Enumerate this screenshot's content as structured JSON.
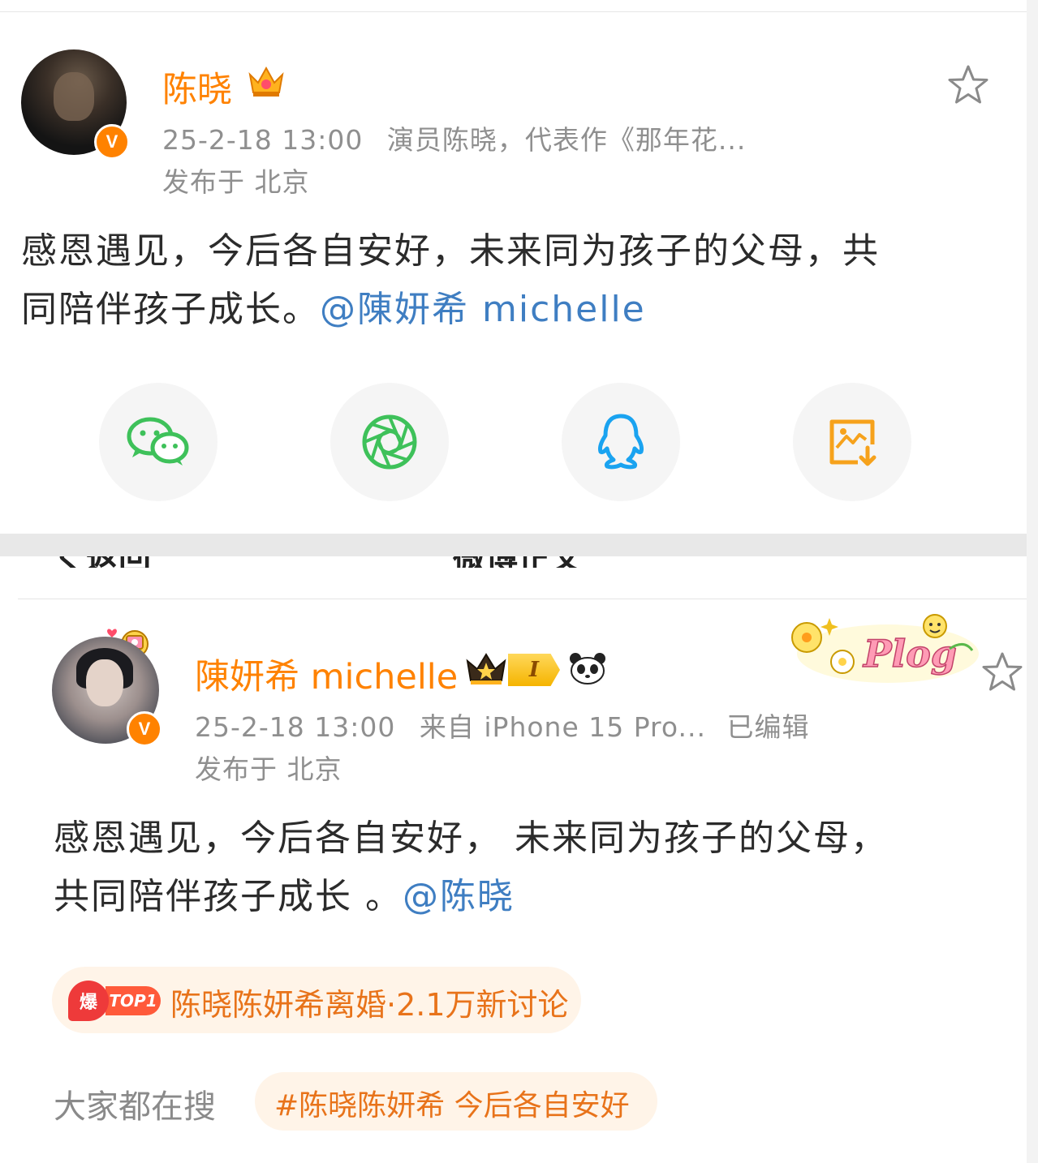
{
  "post1": {
    "author": "陈晓",
    "timestamp": "25-2-18 13:00",
    "bio": "演员陈晓，代表作《那年花...",
    "location": "发布于 北京",
    "content_line1": "感恩遇见，今后各自安好，未来同为孩子的父母，共",
    "content_line2": "同陪伴孩子成长。",
    "mention": "@陳妍希 michelle",
    "verified_badge": "V"
  },
  "share": {
    "icons": [
      "wechat-icon",
      "moments-icon",
      "qq-icon",
      "save-image-icon"
    ]
  },
  "nav_partial": {
    "back": "く返回",
    "title": "微博正文",
    "more": "• • •"
  },
  "post2": {
    "author": "陳妍希 michelle",
    "level": "I",
    "timestamp": "25-2-18 13:00",
    "source": "来自 iPhone 15 Pro...",
    "edited": "已编辑",
    "location": "发布于 北京",
    "content_line1": "感恩遇见，今后各自安好， 未来同为孩子的父母，",
    "content_line2": "共同陪伴孩子成长 。",
    "mention": "@陈晓",
    "verified_badge": "V",
    "sticker_text": "Plog"
  },
  "hot": {
    "badge": "爆",
    "rank": "TOP1",
    "text": "陈晓陈妍希离婚·2.1万新讨论"
  },
  "search": {
    "label": "大家都在搜",
    "tag": "#陈晓陈妍希 今后各自安好"
  },
  "colors": {
    "brand_orange": "#ff8200",
    "mention_blue": "#3f7ec2",
    "wechat_green": "#3ec15a",
    "qq_blue": "#1aa3f0",
    "save_orange": "#f6a21c"
  }
}
